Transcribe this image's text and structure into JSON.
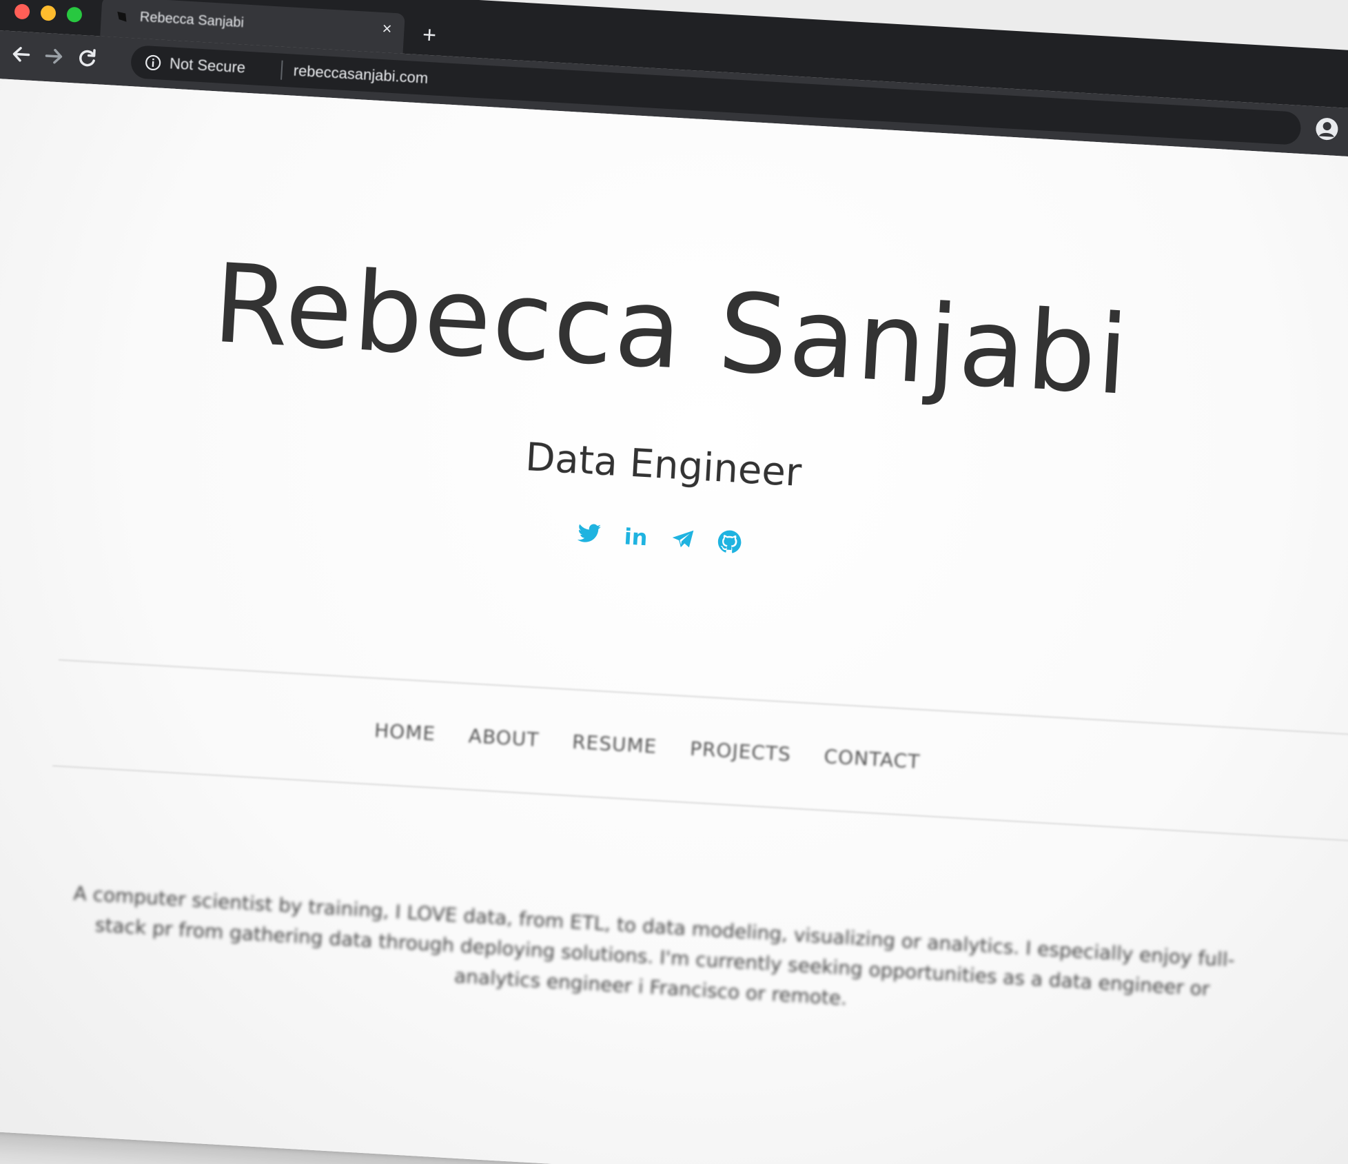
{
  "browser": {
    "tab_title": "Rebecca Sanjabi",
    "tab_close": "×",
    "new_tab": "+",
    "security_label": "Not Secure",
    "url": "rebeccasanjabi.com"
  },
  "hero": {
    "name": "Rebecca Sanjabi",
    "subtitle": "Data Engineer"
  },
  "social": {
    "accent_color": "#1fb3e0",
    "links": [
      "twitter-icon",
      "linkedin-icon",
      "telegram-icon",
      "github-icon"
    ],
    "linkedin_text": "in"
  },
  "nav": {
    "items": [
      "HOME",
      "ABOUT",
      "RESUME",
      "PROJECTS",
      "CONTACT"
    ]
  },
  "about": {
    "bio": "A computer scientist by training, I LOVE data, from ETL, to data modeling, visualizing or analytics. I especially enjoy full-stack pr from gathering data through deploying solutions. I'm currently seeking opportunities as a data engineer or analytics engineer i Francisco or remote."
  }
}
